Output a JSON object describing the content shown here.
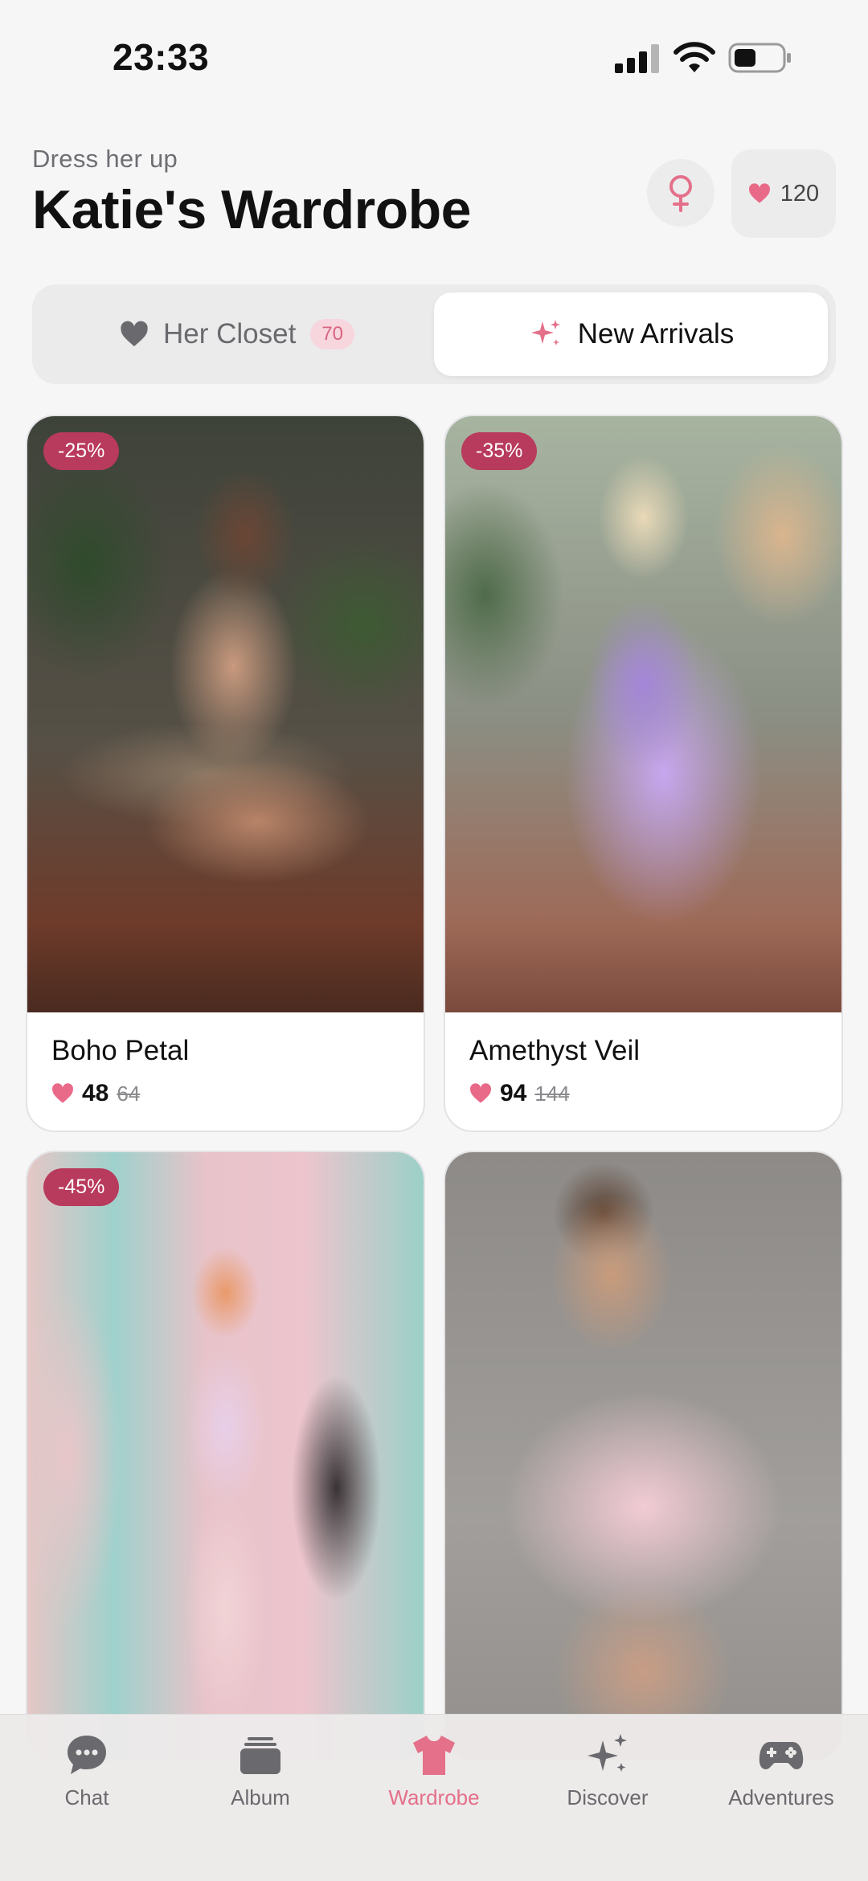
{
  "status_bar": {
    "time": "23:33"
  },
  "header": {
    "subtitle": "Dress her up",
    "title": "Katie's Wardrobe",
    "hearts_balance": "120"
  },
  "tabs": [
    {
      "label": "Her Closet",
      "count": "70",
      "active": false
    },
    {
      "label": "New Arrivals",
      "active": true
    }
  ],
  "items": [
    {
      "name": "Boho Petal",
      "price": "48",
      "old_price": "64",
      "discount": "-25%"
    },
    {
      "name": "Amethyst Veil",
      "price": "94",
      "old_price": "144",
      "discount": "-35%"
    },
    {
      "discount": "-45%"
    },
    {}
  ],
  "nav": [
    {
      "label": "Chat",
      "icon": "chat-bubble-icon"
    },
    {
      "label": "Album",
      "icon": "album-stack-icon"
    },
    {
      "label": "Wardrobe",
      "icon": "tshirt-icon",
      "active": true
    },
    {
      "label": "Discover",
      "icon": "sparkles-icon"
    },
    {
      "label": "Adventures",
      "icon": "gamepad-icon"
    }
  ],
  "colors": {
    "accent": "#e4708a",
    "discount_badge": "#b83a5c",
    "heart": "#e96a88"
  }
}
